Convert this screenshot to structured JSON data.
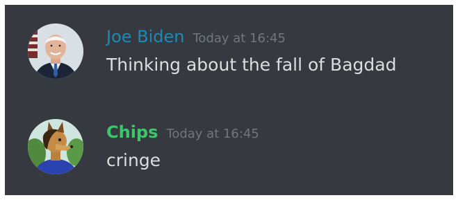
{
  "messages": [
    {
      "author": "Joe Biden",
      "timestamp": "Today at 16:45",
      "content": "Thinking about the fall of Bagdad",
      "author_color": "#1b8ab8",
      "avatar_icon": "person-portrait-avatar"
    },
    {
      "author": "Chips",
      "timestamp": "Today at 16:45",
      "content": "cringe",
      "author_color": "#3ec76a",
      "avatar_icon": "furry-character-avatar"
    }
  ],
  "colors": {
    "background": "#36393f",
    "timestamp": "#72767d",
    "text": "#dcddde"
  }
}
